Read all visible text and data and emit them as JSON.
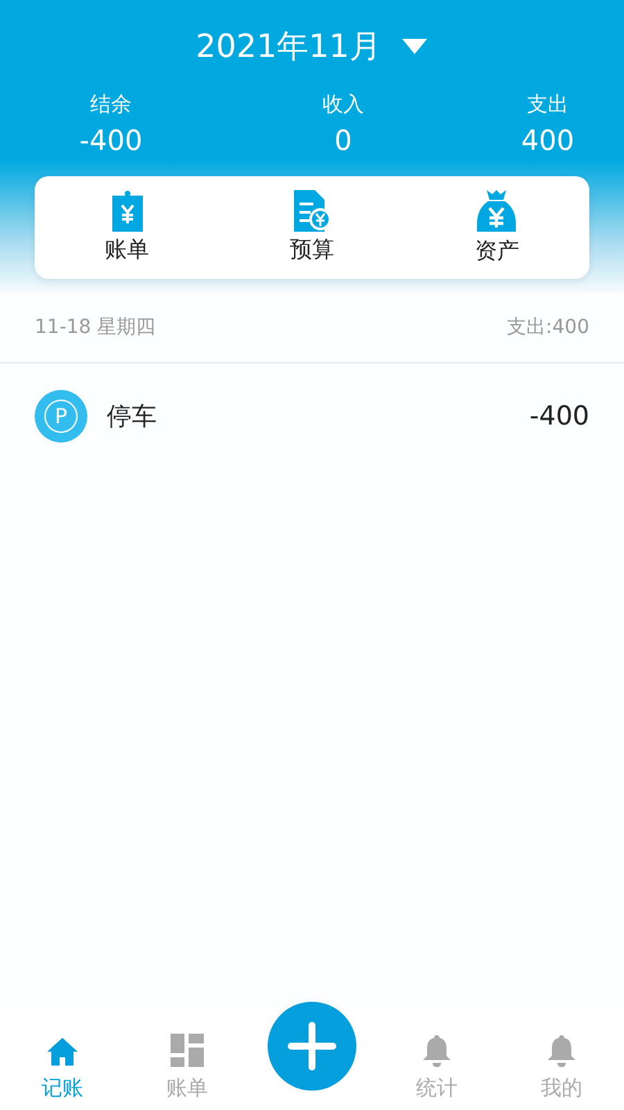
{
  "header": {
    "month": "2021年11月"
  },
  "summary": [
    {
      "label": "结余",
      "value": "-400"
    },
    {
      "label": "收入",
      "value": "0"
    },
    {
      "label": "支出",
      "value": "400"
    }
  ],
  "shortcuts": [
    {
      "label": "账单"
    },
    {
      "label": "预算"
    },
    {
      "label": "资产"
    }
  ],
  "day": {
    "date": "11-18 星期四",
    "total": "支出:400"
  },
  "entries": [
    {
      "symbol": "P",
      "name": "停车",
      "amount": "-400"
    }
  ],
  "nav": [
    {
      "kind": "tab",
      "label": "记账",
      "selected": true
    },
    {
      "kind": "tab",
      "label": "账单",
      "selected": false
    },
    {
      "kind": "add"
    },
    {
      "kind": "tab",
      "label": "统计",
      "selected": false
    },
    {
      "kind": "tab",
      "label": "我的",
      "selected": false
    }
  ]
}
